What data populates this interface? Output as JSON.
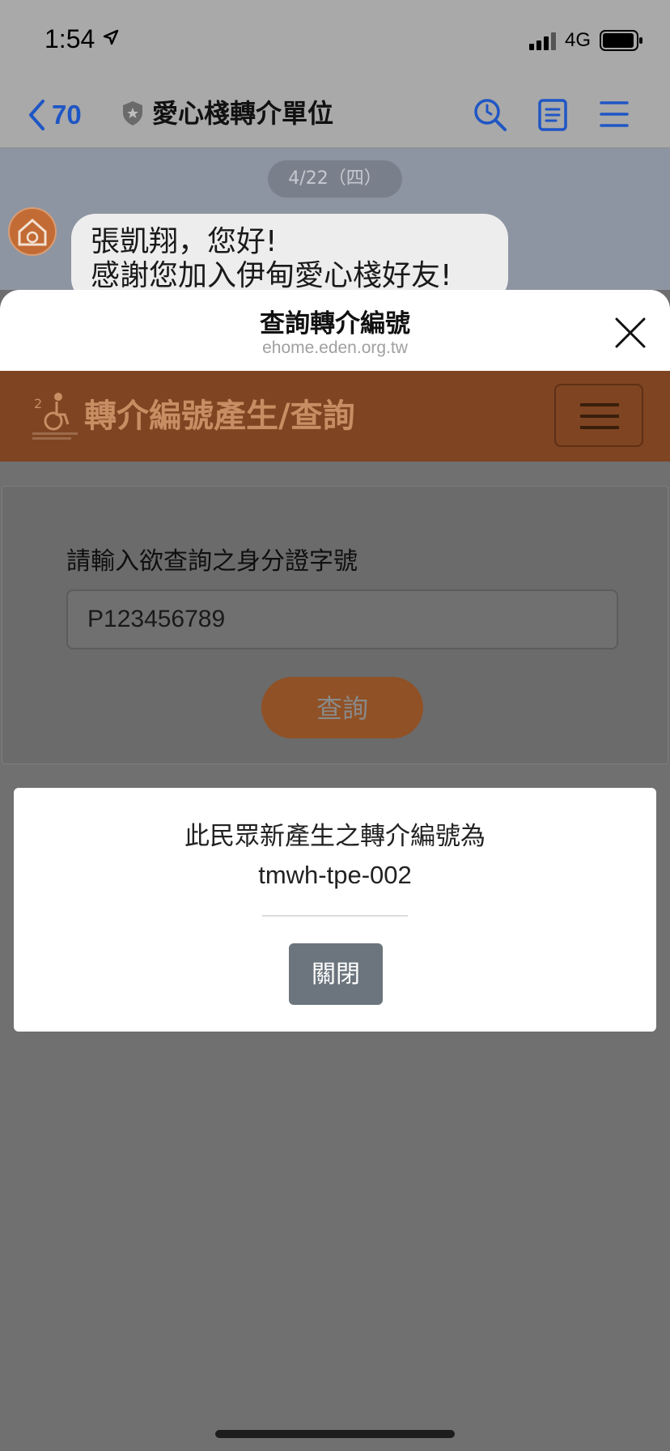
{
  "status_bar": {
    "time": "1:54",
    "network": "4G"
  },
  "chat_header": {
    "back_count": "70",
    "title": "愛心棧轉介單位",
    "accent_color": "#1f56c5"
  },
  "chat": {
    "date": "4/22（四）",
    "message": "張凱翔，您好!\n感謝您加入伊甸愛心棧好友!"
  },
  "panel": {
    "title": "查詢轉介編號",
    "url": "ehome.eden.org.tw"
  },
  "site": {
    "title": "轉介編號產生/查詢",
    "brand_color": "#c86a2a"
  },
  "form": {
    "label": "請輸入欲查詢之身分證字號",
    "id_value": "P123456789",
    "query_button": "查詢"
  },
  "modal": {
    "message": "此民眾新產生之轉介編號為",
    "code": "tmwh-tpe-002",
    "close_button": "關閉"
  }
}
